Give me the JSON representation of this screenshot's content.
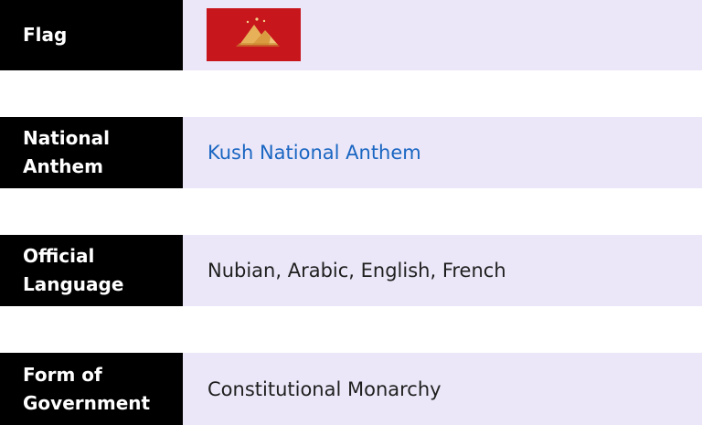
{
  "rows": [
    {
      "label": "Flag",
      "value": ""
    },
    {
      "label_line1": "National",
      "label_line2": "Anthem",
      "value": "Kush National Anthem"
    },
    {
      "label_line1": "Official",
      "label_line2": "Language",
      "value": "Nubian, Arabic, English, French"
    },
    {
      "label_line1": "Form of",
      "label_line2": "Government",
      "value": "Constitutional Monarchy"
    }
  ],
  "colors": {
    "label_bg": "#000000",
    "value_bg": "#ebe7f8",
    "link": "#1a66c2",
    "flag_red": "#c8161d",
    "flag_gold": "#e7b15a"
  },
  "icons": {
    "flag": "pyramids-flag-icon"
  }
}
